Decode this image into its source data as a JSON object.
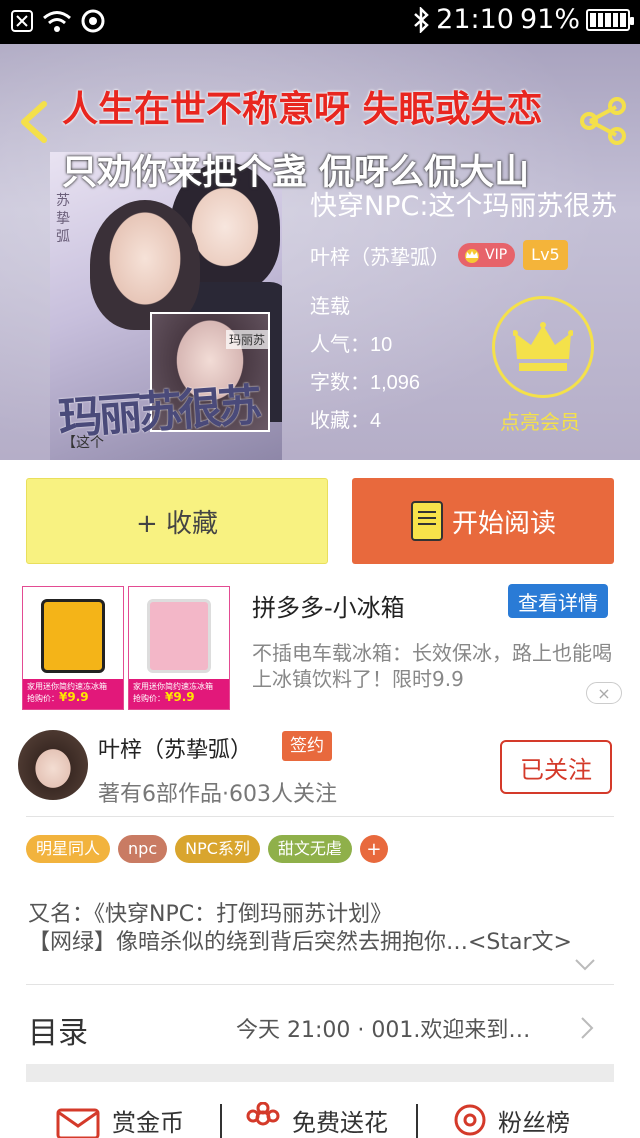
{
  "status_bar": {
    "time": "21:10",
    "battery": "91%"
  },
  "hero": {
    "lyric_line1": "人生在世不称意呀 失眠或失恋",
    "lyric_line2": "只劝你来把个盏 侃呀么侃大山",
    "book_title": "快穿NPC:这个玛丽苏很苏",
    "author": "叶梓（苏挚弧）",
    "vip_label": "VIP",
    "level": "Lv5",
    "serial_status": "连载",
    "popularity_label": "人气：",
    "popularity_value": "10",
    "word_count_label": "字数：",
    "word_count_value": "1,096",
    "favorites_label": "收藏：",
    "favorites_value": "4",
    "member_label": "点亮会员",
    "cover": {
      "title": "玛丽苏很苏",
      "subtitle": "【这个",
      "side_text": "苏挚弧",
      "name_plate": "玛丽苏"
    },
    "colors": {
      "lyric_red": "#e8261f",
      "member_yellow": "#f4e14a"
    }
  },
  "actions": {
    "collect_label": "+ 收藏",
    "read_label": "开始阅读"
  },
  "ad": {
    "title": "拼多多-小冰箱",
    "button": "查看详情",
    "description": "不插电车载冰箱：长效保冰，路上也能喝上冰镇饮料了！限时9.9",
    "close": "×",
    "image1_strip": "家用迷你简约速冻冰箱",
    "image1_price_label": "抢购价：",
    "image1_price": "¥9.9",
    "image2_strip": "家用迷你简约速冻冰箱",
    "image2_price_label": "抢购价：",
    "image2_price": "¥9.9"
  },
  "author_card": {
    "name": "叶梓（苏挚弧）",
    "badge": "签约",
    "summary": "著有6部作品·603人关注",
    "follow_button": "已关注"
  },
  "tags": [
    {
      "label": "明星同人",
      "color": "#f2b33d"
    },
    {
      "label": "npc",
      "color": "#c97b63"
    },
    {
      "label": "NPC系列",
      "color": "#d9a52e"
    },
    {
      "label": "甜文无虐",
      "color": "#8fb04a"
    }
  ],
  "tags_more": "+",
  "intro": {
    "alias": "又名：《快穿NPC：打倒玛丽苏计划》",
    "description": "【网绿】像暗杀似的绕到背后突然去拥抱你…<Star文>"
  },
  "toc": {
    "label": "目录",
    "latest": "今天 21:00 · 001.欢迎来到…"
  },
  "bottom_actions": [
    {
      "label": "赏金币"
    },
    {
      "label": "免费送花"
    },
    {
      "label": "粉丝榜"
    }
  ]
}
